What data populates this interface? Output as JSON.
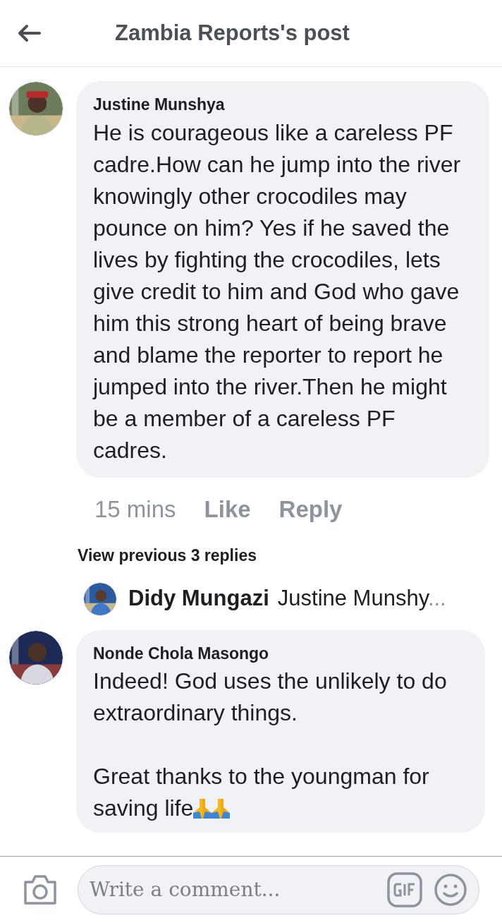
{
  "header": {
    "title": "Zambia Reports's post"
  },
  "comments": [
    {
      "author": "Justine Munshya",
      "paragraphs": [
        "He is courageous like a careless PF cadre.How can he jump into the river knowingly other crocodiles may pounce on him? Yes if he saved the lives by fighting the crocodiles, lets give credit to him and God who gave him this strong heart of being brave and blame the reporter to report he jumped into the river.Then he might be a member of a careless PF cadres."
      ],
      "time": "15 mins",
      "actions": [
        "Like",
        "Reply"
      ],
      "avatar": {
        "kind": "picture"
      }
    },
    {
      "author": "Nonde Chola Masongo",
      "paragraphs": [
        "Indeed! God uses the unlikely to do extraordinary things.",
        "Great thanks to the youngman for saving life"
      ],
      "avatar": {
        "kind": "picture"
      }
    }
  ],
  "replies_link": "View previous 3 replies",
  "reply_preview": {
    "author": "Didy Mungazi",
    "text": "Justine Munshy",
    "ellipsis": "..."
  },
  "composer": {
    "placeholder": "Write a comment..."
  }
}
